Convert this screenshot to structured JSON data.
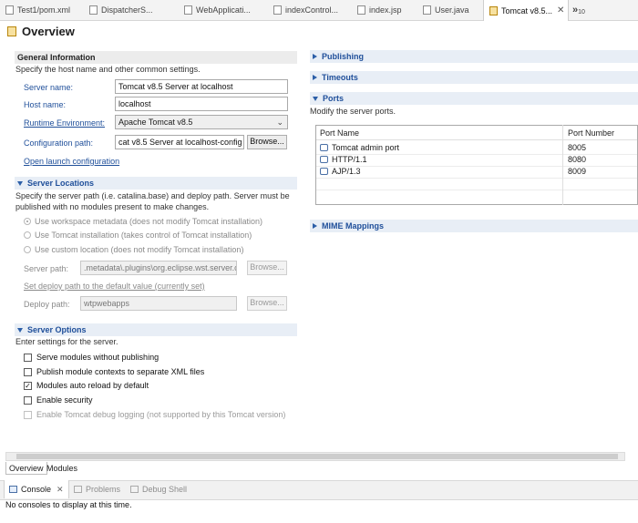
{
  "editor_tabs": [
    {
      "label": "Test1/pom.xml",
      "icon": "xml-file-icon"
    },
    {
      "label": "DispatcherS...",
      "icon": "java-file-icon"
    },
    {
      "label": "WebApplicati...",
      "icon": "java-file-icon"
    },
    {
      "label": "indexControl...",
      "icon": "java-file-icon"
    },
    {
      "label": "index.jsp",
      "icon": "jsp-file-icon"
    },
    {
      "label": "User.java",
      "icon": "java-file-icon"
    },
    {
      "label": "Tomcat v8.5...",
      "icon": "server-icon",
      "close": "✕"
    }
  ],
  "overflow_tabs": {
    "glyph": "»",
    "count": "10"
  },
  "page_title": "Overview",
  "general": {
    "title": "General Information",
    "description": "Specify the host name and other common settings.",
    "server_name_label": "Server name:",
    "server_name_value": "Tomcat v8.5 Server at localhost",
    "host_name_label": "Host name:",
    "host_name_value": "localhost",
    "runtime_label": "Runtime Environment:",
    "runtime_value": "Apache Tomcat v8.5",
    "config_label": "Configuration path:",
    "config_value": "cat v8.5 Server at localhost-config",
    "browse_label": "Browse...",
    "launch_link": "Open launch configuration"
  },
  "locations": {
    "title": "Server Locations",
    "description_line1": "Specify the server path (i.e. catalina.base) and deploy path. Server must be",
    "description_line2": "published with no modules present to make changes.",
    "radio_workspace": "Use workspace metadata (does not modify Tomcat installation)",
    "radio_tomcat": "Use Tomcat installation (takes control of Tomcat installation)",
    "radio_custom": "Use custom location (does not modify Tomcat installation)",
    "server_path_label": "Server path:",
    "server_path_value": ".metadata\\.plugins\\org.eclipse.wst.server.c",
    "browse_label": "Browse...",
    "default_link": "Set deploy path to the default value (currently set)",
    "deploy_path_label": "Deploy path:",
    "deploy_path_value": "wtpwebapps",
    "browse2_label": "Browse..."
  },
  "options": {
    "title": "Server Options",
    "description": "Enter settings for the server.",
    "items": [
      {
        "label": "Serve modules without publishing",
        "checked": false
      },
      {
        "label": "Publish module contexts to separate XML files",
        "checked": false
      },
      {
        "label": "Modules auto reload by default",
        "checked": true
      },
      {
        "label": "Enable security",
        "checked": false
      },
      {
        "label": "Enable Tomcat debug logging (not supported by this Tomcat version)",
        "checked": false
      }
    ]
  },
  "right": {
    "publishing": "Publishing",
    "timeouts": "Timeouts",
    "ports_title": "Ports",
    "ports_description": "Modify the server ports.",
    "col_name": "Port Name",
    "col_number": "Port Number",
    "rows": [
      {
        "name": "Tomcat admin port",
        "number": "8005"
      },
      {
        "name": "HTTP/1.1",
        "number": "8080"
      },
      {
        "name": "AJP/1.3",
        "number": "8009"
      }
    ],
    "mime": "MIME Mappings"
  },
  "bottom_tabs": {
    "overview": "Overview",
    "modules": "Modules"
  },
  "views": {
    "console": "Console",
    "console_close": "✕",
    "problems": "Problems",
    "debug_shell": "Debug Shell",
    "message": "No consoles to display at this time."
  },
  "colors": {
    "accent": "#1f4f9a",
    "section_bg": "#e8eef6"
  }
}
